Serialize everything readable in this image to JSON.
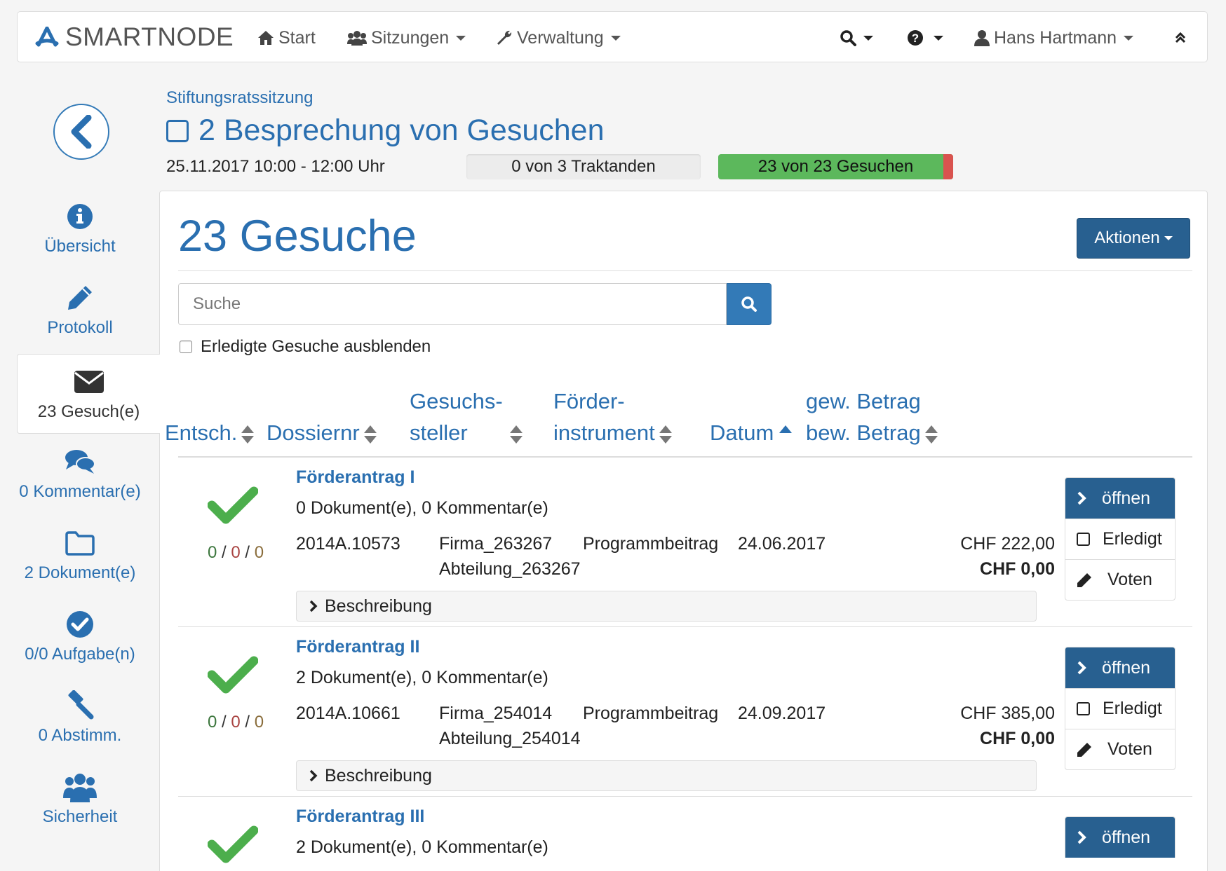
{
  "brand": "SMARTNODE",
  "nav": {
    "start": "Start",
    "sessions": "Sitzungen",
    "admin": "Verwaltung",
    "user": "Hans Hartmann"
  },
  "sidebar": {
    "items": [
      {
        "label": "Übersicht",
        "icon": "info-icon"
      },
      {
        "label": "Protokoll",
        "icon": "pencil-icon"
      },
      {
        "label": "23 Gesuch(e)",
        "icon": "envelope-icon"
      },
      {
        "label": "0 Kommentar(e)",
        "icon": "comments-icon"
      },
      {
        "label": "2 Dokument(e)",
        "icon": "folder-icon"
      },
      {
        "label": "0/0 Aufgabe(n)",
        "icon": "check-circle-icon"
      },
      {
        "label": "0 Abstimm.",
        "icon": "gavel-icon"
      },
      {
        "label": "Sicherheit",
        "icon": "users-icon"
      }
    ]
  },
  "header": {
    "breadcrumb": "Stiftungsratssitzung",
    "title": "2 Besprechung von Gesuchen",
    "datetime": "25.11.2017 10:00 - 12:00 Uhr",
    "progress_traktanden": {
      "label": "0 von 3 Traktanden",
      "value": 0
    },
    "progress_gesuche": {
      "label": "23 von 23 Gesuchen",
      "value": 0.96
    }
  },
  "main": {
    "title": "23 Gesuche",
    "actions_label": "Aktionen",
    "search_placeholder": "Suche",
    "hide_done_label": "Erledigte Gesuche ausblenden",
    "columns": {
      "decision": "Entsch.",
      "dossier": "Dossiernr",
      "applicant_1": "Gesuchs-",
      "applicant_2": "steller",
      "instrument_1": "Förder-",
      "instrument_2": "instrument",
      "date": "Datum",
      "amount_1": "gew. Betrag",
      "amount_2": "bew. Betrag"
    },
    "rows": [
      {
        "title": "Förderantrag I",
        "meta": "0 Dokument(e), 0 Kommentar(e)",
        "counts": {
          "yes": "0",
          "no": "0",
          "abstain": "0"
        },
        "dossier": "2014A.10573",
        "firm": "Firma_263267",
        "dept": "Abteilung_263267",
        "instrument": "Programmbeitrag",
        "date": "24.06.2017",
        "requested": "CHF 222,00",
        "approved": "CHF 0,00",
        "description_label": "Beschreibung",
        "open_label": "öffnen",
        "done_label": "Erledigt",
        "vote_label": "Voten"
      },
      {
        "title": "Förderantrag II",
        "meta": "2 Dokument(e), 0 Kommentar(e)",
        "counts": {
          "yes": "0",
          "no": "0",
          "abstain": "0"
        },
        "dossier": "2014A.10661",
        "firm": "Firma_254014",
        "dept": "Abteilung_254014",
        "instrument": "Programmbeitrag",
        "date": "24.09.2017",
        "requested": "CHF 385,00",
        "approved": "CHF 0,00",
        "description_label": "Beschreibung",
        "open_label": "öffnen",
        "done_label": "Erledigt",
        "vote_label": "Voten"
      },
      {
        "title": "Förderantrag III",
        "meta": "2 Dokument(e), 0 Kommentar(e)",
        "open_label": "öffnen"
      }
    ]
  },
  "colors": {
    "primary": "#337ab7",
    "primary_dark": "#286090",
    "success": "#5cb85c",
    "danger": "#d9534f",
    "check": "#4cae4c"
  }
}
